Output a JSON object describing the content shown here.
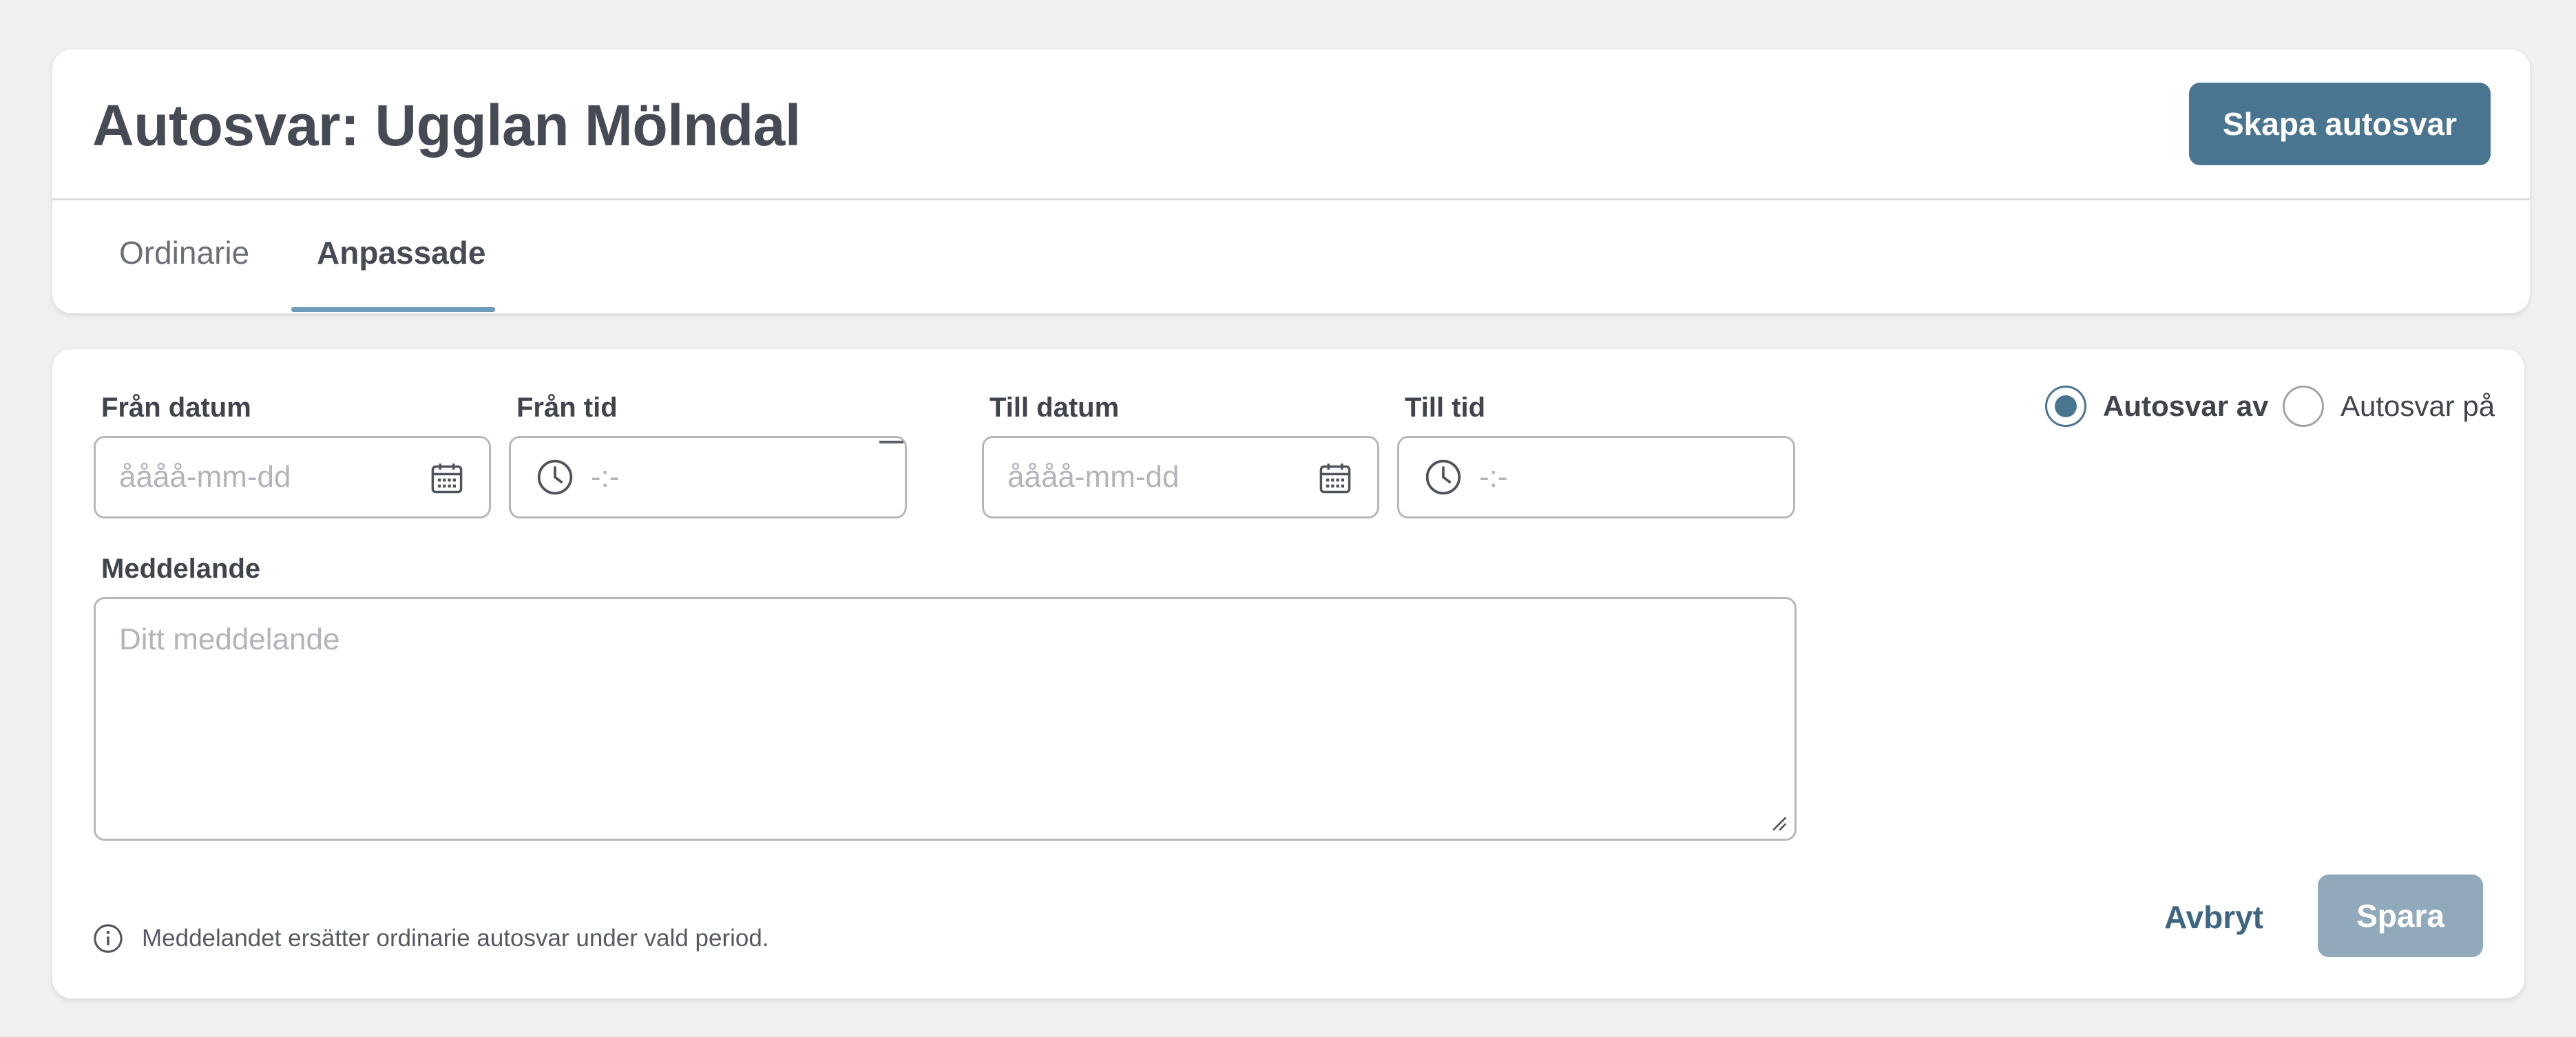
{
  "header": {
    "title": "Autosvar: Ugglan Mölndal",
    "create_button": "Skapa autosvar"
  },
  "tabs": [
    {
      "label": "Ordinarie",
      "active": false
    },
    {
      "label": "Anpassade",
      "active": true
    }
  ],
  "form": {
    "from_date": {
      "label": "Från datum",
      "placeholder": "åååå-mm-dd",
      "icon": "calendar-icon"
    },
    "from_time": {
      "label": "Från tid",
      "placeholder": "-:-",
      "icon": "clock-icon"
    },
    "to_date": {
      "label": "Till datum",
      "placeholder": "åååå-mm-dd",
      "icon": "calendar-icon"
    },
    "to_time": {
      "label": "Till tid",
      "placeholder": "-:-",
      "icon": "clock-icon"
    },
    "message": {
      "label": "Meddelande",
      "placeholder": "Ditt meddelande"
    },
    "status_options": [
      {
        "label": "Autosvar av",
        "checked": true
      },
      {
        "label": "Autosvar på",
        "checked": false
      }
    ],
    "info_text": "Meddelandet ersätter ordinarie autosvar under vald period.",
    "cancel_label": "Avbryt",
    "save_label": "Spara"
  },
  "colors": {
    "primary": "#4a7590",
    "primary_disabled": "#91aabb",
    "tab_underline": "#6f9cb8",
    "background": "#f0f0f0"
  }
}
